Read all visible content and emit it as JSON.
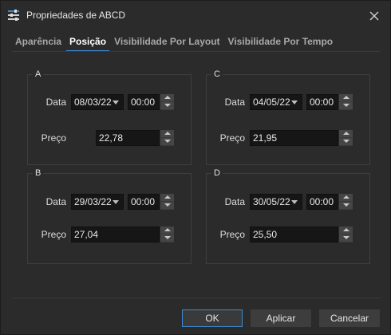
{
  "window": {
    "title": "Propriedades de ABCD",
    "icon": "settings-sliders-icon"
  },
  "tabs": [
    {
      "label": "Aparência",
      "active": false
    },
    {
      "label": "Posição",
      "active": true
    },
    {
      "label": "Visibilidade Por Layout",
      "active": false
    },
    {
      "label": "Visibilidade Por Tempo",
      "active": false
    }
  ],
  "labels": {
    "date": "Data",
    "price": "Preço"
  },
  "points": {
    "A": {
      "name": "A",
      "date": "08/03/22",
      "time": "00:00",
      "price": "22,78"
    },
    "B": {
      "name": "B",
      "date": "29/03/22",
      "time": "00:00",
      "price": "27,04"
    },
    "C": {
      "name": "C",
      "date": "04/05/22",
      "time": "00:00",
      "price": "21,95"
    },
    "D": {
      "name": "D",
      "date": "30/05/22",
      "time": "00:00",
      "price": "25,50"
    }
  },
  "buttons": {
    "ok": "OK",
    "apply": "Aplicar",
    "cancel": "Cancelar"
  },
  "colors": {
    "background": "#2b2b2b",
    "accent": "#3c8bd0",
    "field": "#161616"
  }
}
